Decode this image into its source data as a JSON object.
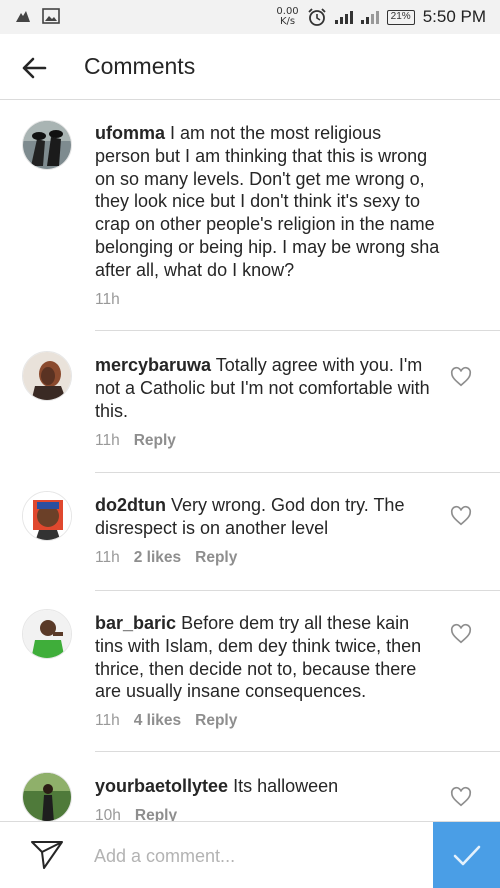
{
  "status_bar": {
    "speed_value": "0.00",
    "speed_unit": "K/s",
    "battery": "21%",
    "time": "5:50 PM",
    "icons": [
      "notification-icon",
      "image-icon",
      "alarm-icon",
      "signal-icon",
      "battery-icon"
    ]
  },
  "header": {
    "title": "Comments",
    "back_icon": "arrow-left-icon"
  },
  "comments": [
    {
      "user": "ufomma",
      "text": "I am not the most religious person but I am thinking that this is wrong on so many levels. Don't get me wrong o, they look nice but I don't think it's sexy to crap on other people's religion in the name belonging or being hip. I may be wrong sha after all, what do I know?",
      "time": "11h",
      "likes": "",
      "reply": ""
    },
    {
      "user": "mercybaruwa",
      "text": "Totally agree with you. I'm not a Catholic but I'm not comfortable with this.",
      "time": "11h",
      "likes": "",
      "reply": "Reply"
    },
    {
      "user": "do2dtun",
      "text": "Very wrong. God don try. The disrespect is on another level",
      "time": "11h",
      "likes": "2 likes",
      "reply": "Reply"
    },
    {
      "user": "bar_baric",
      "text": "Before dem try all these kain tins with Islam, dem dey think twice, then thrice, then decide not to, because there are usually insane consequences.",
      "time": "11h",
      "likes": "4 likes",
      "reply": "Reply"
    },
    {
      "user": "yourbaetollytee",
      "text": "Its halloween",
      "time": "10h",
      "likes": "",
      "reply": "Reply"
    }
  ],
  "composer": {
    "placeholder": "Add a comment...",
    "value": "",
    "send_icon": "paper-plane-icon",
    "post_icon": "checkmark-icon"
  },
  "colors": {
    "accent": "#4a9ee6",
    "text": "#262626",
    "muted": "#999999",
    "divider": "#dbdbdb"
  }
}
